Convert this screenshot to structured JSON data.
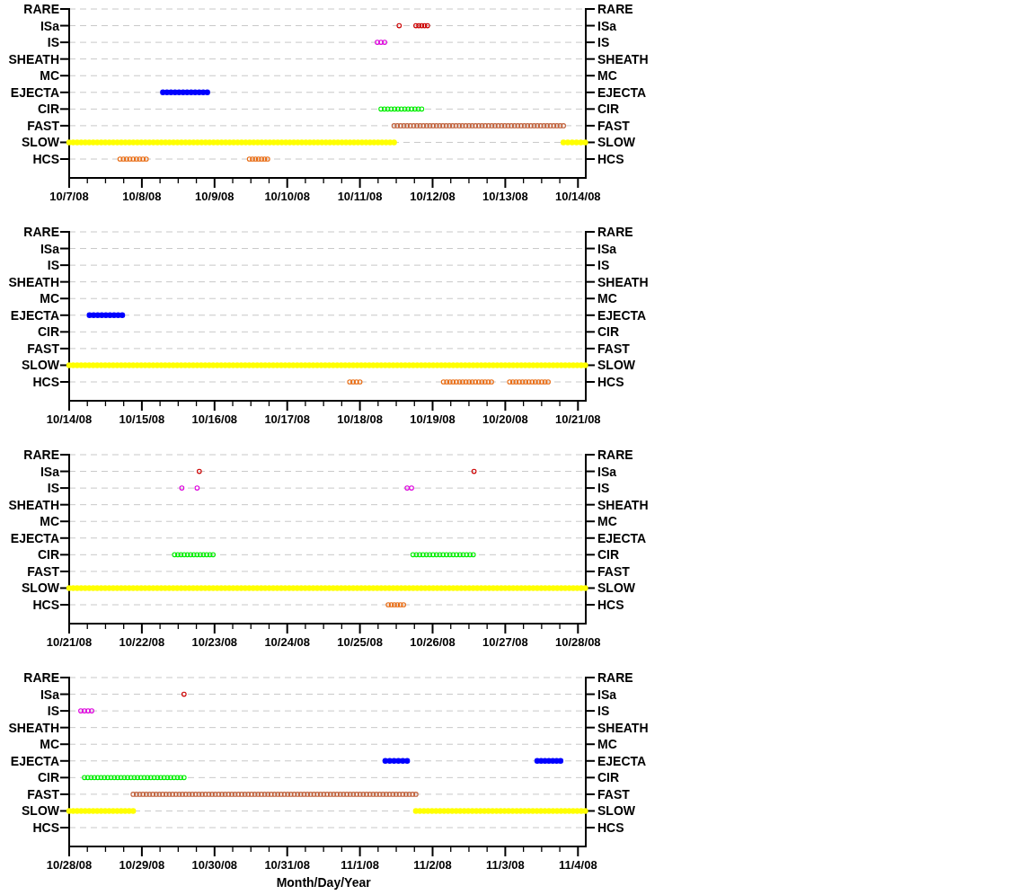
{
  "panels": [
    {
      "left_labels": [
        "RARE",
        "ISa",
        "IS",
        "SHEATH",
        "MC",
        "EJECTA",
        "CIR",
        "FAST",
        "SLOW",
        "HCS"
      ],
      "right_labels": [
        "RARE",
        "ISa",
        "IS",
        "SHEATH",
        "MC",
        "EJECTA",
        "CIR",
        "FAST",
        "SLOW",
        "HCS"
      ],
      "date_labels": [
        "10/7/08",
        "10/8/08",
        "10/9/08",
        "10/10/08",
        "10/11/08",
        "10/12/08",
        "10/13/08",
        "10/14/08"
      ]
    },
    {
      "left_labels": [
        "RARE",
        "ISa",
        "IS",
        "SHEATH",
        "MC",
        "EJECTA",
        "CIR",
        "FAST",
        "SLOW",
        "HCS"
      ],
      "right_labels": [
        "RARE",
        "ISa",
        "IS",
        "SHEATH",
        "MC",
        "EJECTA",
        "CIR",
        "FAST",
        "SLOW",
        "HCS"
      ],
      "date_labels": [
        "10/14/08",
        "10/15/08",
        "10/16/08",
        "10/17/08",
        "10/18/08",
        "10/19/08",
        "10/20/08",
        "10/21/08"
      ]
    },
    {
      "left_labels": [
        "RARE",
        "ISa",
        "IS",
        "SHEATH",
        "MC",
        "EJECTA",
        "CIR",
        "FAST",
        "SLOW",
        "HCS"
      ],
      "right_labels": [
        "RARE",
        "ISa",
        "IS",
        "SHEATH",
        "MC",
        "EJECTA",
        "CIR",
        "FAST",
        "SLOW",
        "HCS"
      ],
      "date_labels": [
        "10/21/08",
        "10/22/08",
        "10/23/08",
        "10/24/08",
        "10/25/08",
        "10/26/08",
        "10/27/08",
        "10/28/08"
      ]
    },
    {
      "left_labels": [
        "RARE",
        "ISa",
        "IS",
        "SHEATH",
        "MC",
        "EJECTA",
        "CIR",
        "FAST",
        "SLOW",
        "HCS"
      ],
      "right_labels": [
        "RARE",
        "ISa",
        "IS",
        "SHEATH",
        "MC",
        "EJECTA",
        "CIR",
        "FAST",
        "SLOW",
        "HCS"
      ],
      "date_labels": [
        "10/28/08",
        "10/29/08",
        "10/30/08",
        "10/31/08",
        "11/1/08",
        "11/2/08",
        "11/3/08",
        "11/4/08"
      ],
      "xlabel": "Month/Day/Year"
    }
  ]
}
